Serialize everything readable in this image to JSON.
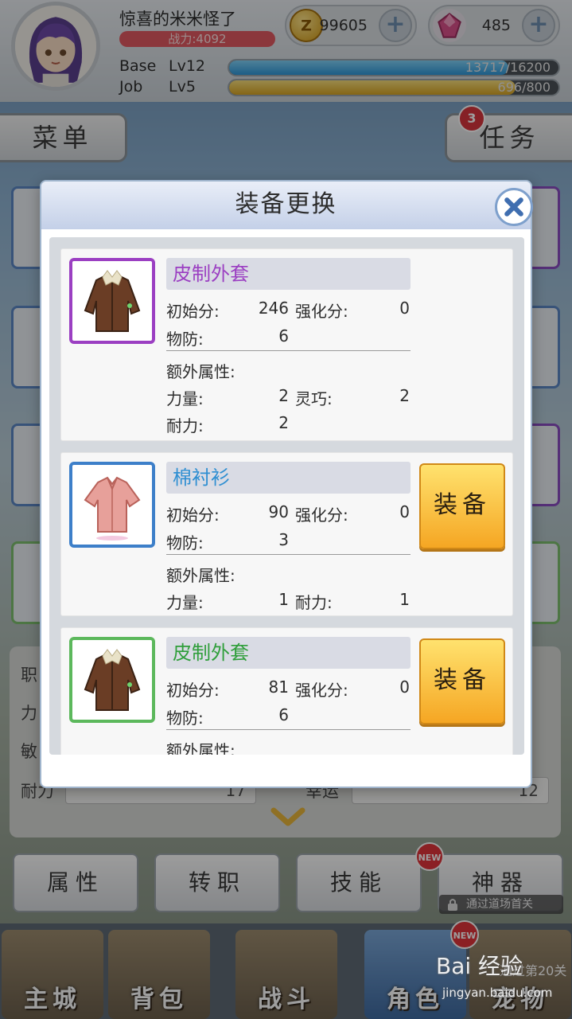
{
  "player": {
    "name": "惊喜的米米怪了",
    "power": "战力:4092",
    "base_label": "Base",
    "base_level": "Lv12",
    "base_exp": "13717/16200",
    "base_progress": 0.847,
    "job_label": "Job",
    "job_level": "Lv5",
    "job_exp": "696/800",
    "job_progress": 0.87
  },
  "currency": {
    "zeny": "99605",
    "zeny_icon": "zeny-coin-icon",
    "gems": "485",
    "gems_icon": "pink-gem-icon",
    "add_symbol": "+"
  },
  "top_buttons": {
    "menu": "菜单",
    "task": "任务",
    "task_count": "3"
  },
  "stats_panel": {
    "rows": [
      {
        "label": "职"
      },
      {
        "label": "力"
      },
      {
        "label": "敏"
      },
      {
        "label": "耐力",
        "value": "17",
        "right_label": "幸运",
        "right_value": "12"
      }
    ]
  },
  "action_buttons": {
    "attr": "属性",
    "job_change": "转职",
    "skill": "技能",
    "artifact": "神器",
    "new_badge": "NEW",
    "artifact_lock": "通过道场首关"
  },
  "bottom_nav": {
    "items": [
      "主城",
      "背包",
      "战斗",
      "角色",
      "宠物"
    ],
    "stage_tip": "通过第20关"
  },
  "modal": {
    "title": "装备更换",
    "close_icon": "close-icon",
    "equip_label": "装备",
    "items": [
      {
        "name": "皮制外套",
        "name_color": "#9b3fc2",
        "frame_color": "#9b3fc2",
        "init_label": "初始分:",
        "init_value": "246",
        "enh_label": "强化分:",
        "enh_value": "0",
        "def_label": "物防:",
        "def_value": "6",
        "extra_label": "额外属性:",
        "attrs": [
          {
            "label": "力量:",
            "value": "2"
          },
          {
            "label": "灵巧:",
            "value": "2"
          },
          {
            "label": "耐力:",
            "value": "2"
          }
        ],
        "equipped": true
      },
      {
        "name": "棉衬衫",
        "name_color": "#2f8fd2",
        "frame_color": "#3d7fc9",
        "init_label": "初始分:",
        "init_value": "90",
        "enh_label": "强化分:",
        "enh_value": "0",
        "def_label": "物防:",
        "def_value": "3",
        "extra_label": "额外属性:",
        "attrs": [
          {
            "label": "力量:",
            "value": "1"
          },
          {
            "label": "耐力:",
            "value": "1"
          }
        ],
        "equipped": false
      },
      {
        "name": "皮制外套",
        "name_color": "#2f9e3a",
        "frame_color": "#5cb85c",
        "init_label": "初始分:",
        "init_value": "81",
        "enh_label": "强化分:",
        "enh_value": "0",
        "def_label": "物防:",
        "def_value": "6",
        "extra_label": "额外属性:",
        "attrs": [],
        "equipped": false
      }
    ]
  },
  "watermark": {
    "brand": "Bai 经验",
    "url": "jingyan.baidu.com"
  }
}
